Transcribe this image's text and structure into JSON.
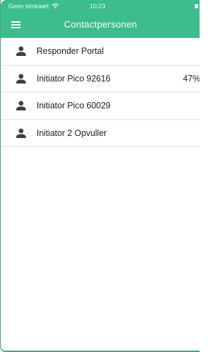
{
  "status_bar": {
    "carrier": "Geen simkaart",
    "time": "10:23"
  },
  "nav": {
    "title": "Contactpersonen",
    "menu_icon": "hamburger-menu-icon"
  },
  "colors": {
    "header": "#3dbd8c",
    "divider": "#e1e1e1",
    "text": "#1c1c1c",
    "icon": "#3f3f3f"
  },
  "contacts": [
    {
      "name": "Responder Portal",
      "icon": "person-icon",
      "level": ""
    },
    {
      "name": "Initiator Pico 92616",
      "icon": "person-icon",
      "level": "47%"
    },
    {
      "name": "Initiator Pico 60029",
      "icon": "person-icon",
      "level": ""
    },
    {
      "name": "Initiator 2 Opvuller",
      "icon": "person-icon",
      "level": ""
    }
  ]
}
